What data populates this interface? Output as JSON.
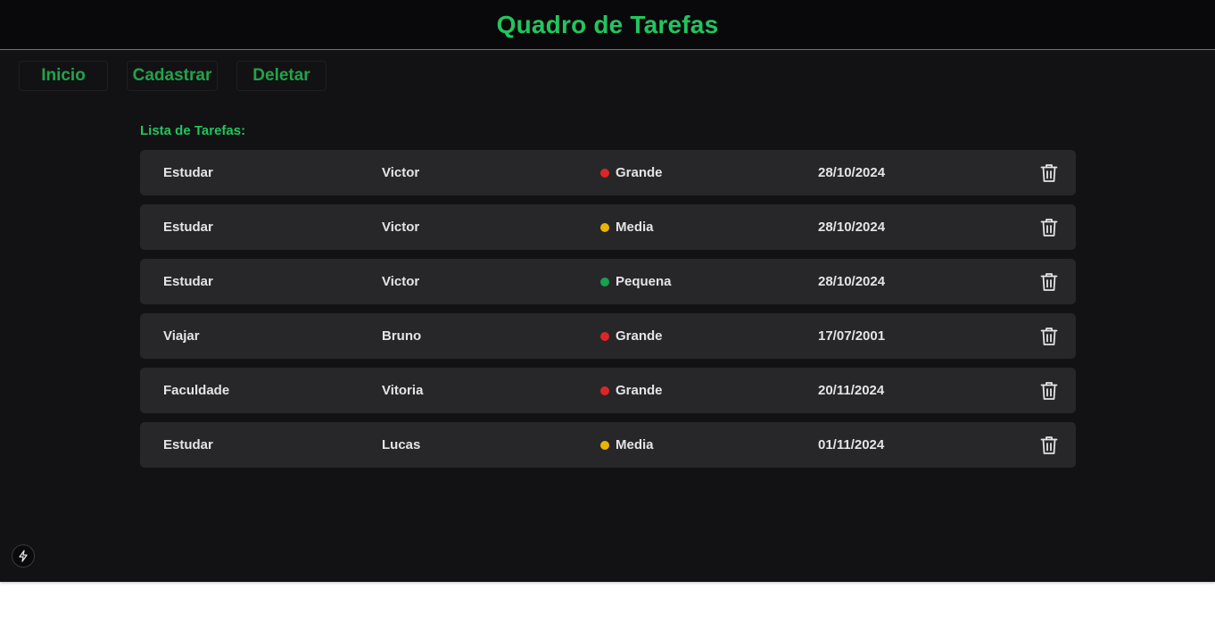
{
  "header": {
    "title": "Quadro de Tarefas"
  },
  "nav": {
    "home_label": "Inicio",
    "register_label": "Cadastrar",
    "delete_label": "Deletar"
  },
  "list": {
    "title": "Lista de Tarefas:",
    "tasks": [
      {
        "task": "Estudar",
        "person": "Victor",
        "size": "Grande",
        "size_color": "#dc2626",
        "date": "28/10/2024"
      },
      {
        "task": "Estudar",
        "person": "Victor",
        "size": "Media",
        "size_color": "#eab308",
        "date": "28/10/2024"
      },
      {
        "task": "Estudar",
        "person": "Victor",
        "size": "Pequena",
        "size_color": "#16a34a",
        "date": "28/10/2024"
      },
      {
        "task": "Viajar",
        "person": "Bruno",
        "size": "Grande",
        "size_color": "#dc2626",
        "date": "17/07/2001"
      },
      {
        "task": "Faculdade",
        "person": "Vitoria",
        "size": "Grande",
        "size_color": "#dc2626",
        "date": "20/11/2024"
      },
      {
        "task": "Estudar",
        "person": "Lucas",
        "size": "Media",
        "size_color": "#eab308",
        "date": "01/11/2024"
      }
    ]
  },
  "icons": {
    "delete": "trash-icon",
    "devtools": "lightning-bolt-icon"
  },
  "colors": {
    "accent": "#22c55e",
    "background": "#121214",
    "header_background": "#09090b",
    "row_background": "#27272a"
  }
}
